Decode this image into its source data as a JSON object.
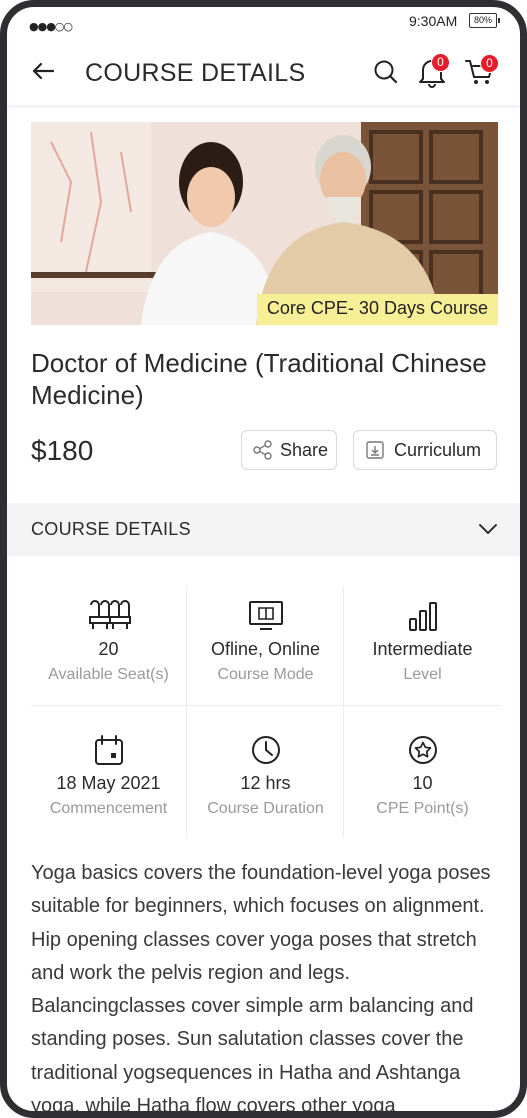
{
  "status_bar": {
    "signal": "●●●○○",
    "time": "9:30AM",
    "battery": "80%"
  },
  "header": {
    "title": "COURSE DETAILS",
    "notification_count": "0",
    "cart_count": "0"
  },
  "hero": {
    "tag": "Core CPE- 30 Days Course"
  },
  "course": {
    "title": "Doctor of Medicine (Traditional Chinese Medicine)",
    "price": "$180"
  },
  "actions": {
    "share_label": "Share",
    "curriculum_label": "Curriculum"
  },
  "section": {
    "label": "COURSE DETAILS"
  },
  "details": [
    {
      "icon": "seats-icon",
      "value": "20",
      "label": "Available Seat(s)"
    },
    {
      "icon": "monitor-book-icon",
      "value": "Ofline, Online",
      "label": "Course Mode"
    },
    {
      "icon": "bar-chart-icon",
      "value": "Intermediate",
      "label": "Level"
    },
    {
      "icon": "calendar-icon",
      "value": "18 May 2021",
      "label": "Commencement"
    },
    {
      "icon": "clock-icon",
      "value": "12 hrs",
      "label": "Course Duration"
    },
    {
      "icon": "star-icon",
      "value": "10",
      "label": "CPE Point(s)"
    }
  ],
  "description": "Yoga basics covers the foundation-level yoga poses suitable for beginners, which focuses on alignment. Hip opening classes cover yoga poses that stretch and work the pelvis region and legs. Balancingclasses cover simple arm balancing and standing poses. Sun salutation classes cover the traditional yogsequences in Hatha and Ashtanga yoga, while Hatha flow covers other yoga"
}
